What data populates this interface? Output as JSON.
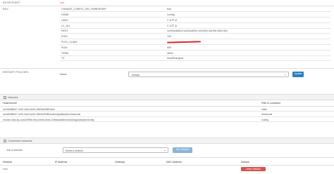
{
  "entrypoint": {
    "label": "ENTRYPOINT",
    "value": "/init"
  },
  "env": {
    "label": "ENV",
    "rows": [
      {
        "key": "CHANGE_CONFIG_DIR_OWNERSHIP",
        "value": "true"
      },
      {
        "key": "HOME",
        "value": "/config"
      },
      {
        "key": "LANG",
        "value": "C.UTF-8"
      },
      {
        "key": "LC_ALL",
        "value": "C.UTF-8"
      },
      {
        "key": "PATH",
        "value": "/usr/local/sbin:/usr/local/bin:/usr/sbin:/usr/bin:/sbin:/bin"
      },
      {
        "key": "PGID",
        "value": "100"
      },
      {
        "key": "PLEX_CLAIM",
        "value": ""
      },
      {
        "key": "PUID",
        "value": "999"
      },
      {
        "key": "TERM",
        "value": "xterm"
      },
      {
        "key": "TZ",
        "value": "Asia/Shanghai"
      }
    ]
  },
  "restart_policies": {
    "label": "RESTART POLICIES",
    "name_label": "Name",
    "selected": "Always",
    "update_button": "Update"
  },
  "volumes": {
    "section_title": "Volumes",
    "col_host": "Host/volume",
    "col_container": "Path in container",
    "rows": [
      {
        "host": "/srv/6b6850e7-c430-4a02-be0b-cf9e9dd20f8/video",
        "container": "/data"
      },
      {
        "host": "/srv/6b6850e7-c430-4a02-be0b-cf9e9dd20f8/dockerappdata/plex/transcode",
        "container": "/transcode"
      },
      {
        "host": "/srv/dev-disk-by-uuid-b2f9fcb-96cd-46ed-8ebc-2c9bddaeb8ce/dockerappdata/plex/config",
        "container": "/config"
      }
    ]
  },
  "networks": {
    "section_title": "Connected networks",
    "join_label": "Join a network",
    "select_placeholder": "Select a network",
    "join_button": "Join network",
    "columns": [
      "Network",
      "IP Address",
      "Gateway",
      "MAC Address",
      "Actions"
    ],
    "rows": [
      {
        "network": "host",
        "ip": "",
        "gateway": "",
        "mac": "",
        "action": "Leave network"
      }
    ]
  }
}
